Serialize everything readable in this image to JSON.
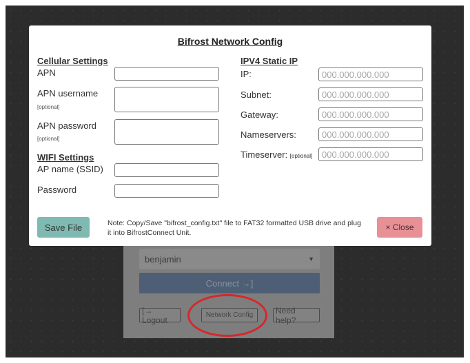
{
  "background_page": {
    "user_select": "benjamin",
    "connect_label": "Connect →]",
    "logout_label": "[→ Logout",
    "network_config_label": "Network Config",
    "help_label": "Need help?"
  },
  "modal": {
    "title": "Bifrost Network Config",
    "cellular": {
      "heading": "Cellular Settings",
      "apn_label": "APN",
      "apn_value": "",
      "apn_username_label": "APN username",
      "apn_username_hint": "[optional]",
      "apn_username_value": "",
      "apn_password_label": "APN password",
      "apn_password_hint": "[optional]",
      "apn_password_value": ""
    },
    "wifi": {
      "heading": "WIFI Settings",
      "ssid_label": "AP name (SSID)",
      "ssid_value": "",
      "password_label": "Password",
      "password_value": ""
    },
    "ipv4": {
      "heading": "IPV4 Static IP",
      "ip_label": "IP:",
      "ip_placeholder": "000.000.000.000",
      "subnet_label": "Subnet:",
      "subnet_placeholder": "000.000.000.000",
      "gateway_label": "Gateway:",
      "gateway_placeholder": "000.000.000.000",
      "nameservers_label": "Nameservers:",
      "nameservers_placeholder": "000.000.000.000",
      "timeserver_label": "Timeserver:",
      "timeserver_hint": "[optional]",
      "timeserver_placeholder": "000.000.000.000"
    },
    "note": "Note: Copy/Save \"bifrost_config.txt\" file to FAT32 formatted USB drive and plug it into BifrostConnect Unit.",
    "save_label": "Save File",
    "close_label": "× Close"
  },
  "colors": {
    "save_button": "#7fbab2",
    "close_button": "#e79096",
    "highlight_circle": "#d8262c",
    "overlay": "#2c2c2c"
  }
}
